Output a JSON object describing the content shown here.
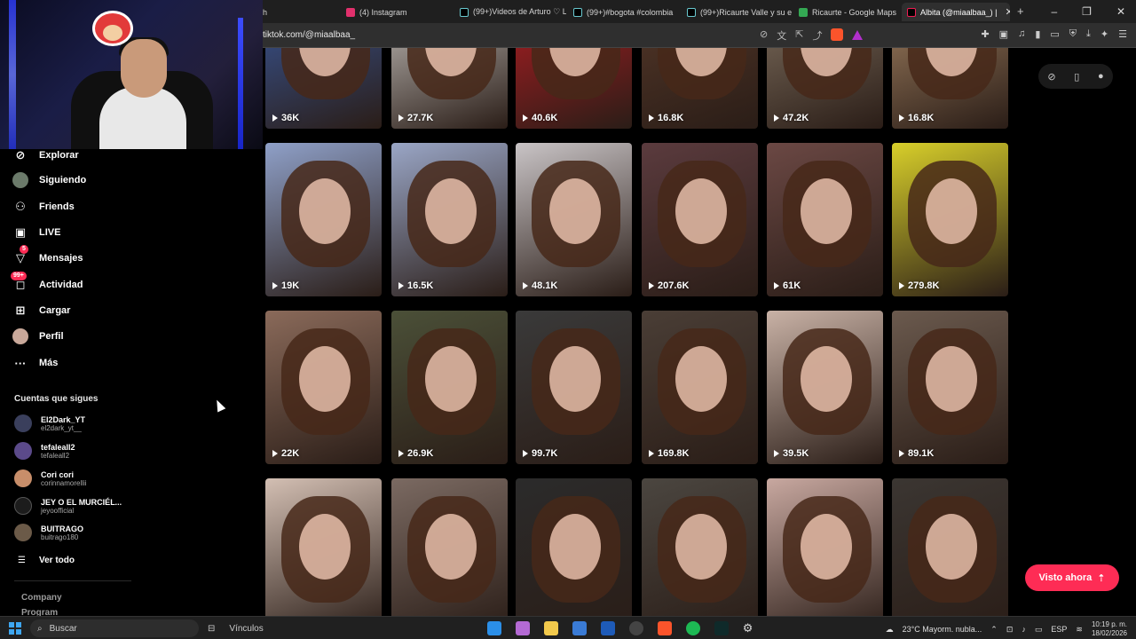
{
  "browser": {
    "tabs": [
      {
        "label": "h",
        "color": "#1f1f1f"
      },
      {
        "label": "(4) Instagram",
        "color": "#e1306c"
      },
      {
        "label": "(99+)Videos de Arturo ♡ L",
        "color": "#000000"
      },
      {
        "label": "(99+)#bogota #colombia",
        "color": "#000000"
      },
      {
        "label": "(99+)Ricaurte Valle y su ex",
        "color": "#000000"
      },
      {
        "label": "Ricaurte - Google Maps",
        "color": "#34a853"
      },
      {
        "label": "Albita (@miaalbaa_) |",
        "color": "#000000"
      }
    ],
    "url": "tiktok.com/@miaalbaa_"
  },
  "sidebar": {
    "nav": [
      {
        "label": "Explorar",
        "icon": "compass-icon"
      },
      {
        "label": "Siguiendo",
        "icon": "following-avatar-icon"
      },
      {
        "label": "Friends",
        "icon": "friends-icon"
      },
      {
        "label": "LIVE",
        "icon": "live-icon"
      },
      {
        "label": "Mensajes",
        "icon": "messages-icon",
        "badge": "5"
      },
      {
        "label": "Actividad",
        "icon": "activity-icon",
        "badge": "99+"
      },
      {
        "label": "Cargar",
        "icon": "upload-icon"
      },
      {
        "label": "Perfil",
        "icon": "profile-icon"
      },
      {
        "label": "Más",
        "icon": "more-icon"
      }
    ],
    "following_title": "Cuentas que sigues",
    "accounts": [
      {
        "name": "El2Dark_YT",
        "handle": "el2dark_yt__",
        "color": "#3a3f5c"
      },
      {
        "name": "tefaleall2",
        "handle": "tefaleall2",
        "color": "#5b4a8a"
      },
      {
        "name": "Cori cori",
        "handle": "corinnamorellii",
        "color": "#c88e6a"
      },
      {
        "name": "JEY O EL MURCIÉL...",
        "handle": "jeyoofficial",
        "color": "#1c1c1c"
      },
      {
        "name": "BUITRAGO",
        "handle": "buitrago180",
        "color": "#6b5a48"
      }
    ],
    "see_all": "Ver todo",
    "footer": [
      "Company",
      "Program"
    ]
  },
  "grid": {
    "rows": [
      [
        "36K",
        "27.7K",
        "40.6K",
        "16.8K",
        "47.2K",
        "16.8K"
      ],
      [
        "19K",
        "16.5K",
        "48.1K",
        "207.6K",
        "61K",
        "279.8K"
      ],
      [
        "22K",
        "26.9K",
        "99.7K",
        "169.8K",
        "39.5K",
        "89.1K"
      ],
      [
        "",
        "",
        "",
        "",
        "",
        ""
      ]
    ],
    "tile_colors": [
      [
        "#3b5ea8",
        "#d9d6d2",
        "#c21d24",
        "#5a3b2b",
        "#8a7a68",
        "#b08d6a"
      ],
      [
        "#8fa0c8",
        "#9aa6c6",
        "#c9c4c6",
        "#5b3b3e",
        "#6b4844",
        "#d8cf2a"
      ],
      [
        "#8a6a5a",
        "#4b5038",
        "#3a3a3a",
        "#4a3e36",
        "#c9b2a6",
        "#6b5a4e"
      ],
      [
        "#d3bfb3",
        "#7b6a62",
        "#2b2b2b",
        "#4b4640",
        "#c8a8a0",
        "#3b3632"
      ]
    ]
  },
  "controls": {
    "visto_label": "Visto ahora"
  },
  "taskbar": {
    "search_placeholder": "Buscar",
    "vinculos": "Vínculos",
    "weather": "23°C  Mayorm. nubla...",
    "lang": "ESP",
    "time": "10:19 p. m.",
    "date": "18/02/2026"
  }
}
